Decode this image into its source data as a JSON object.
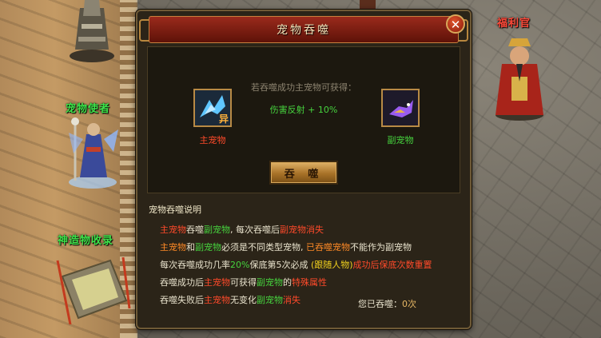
{
  "npcs": {
    "pet_envoy": "宠物使者",
    "welfare_officer": "福利官",
    "artifact_collector": "神造物收录"
  },
  "dialog": {
    "title": "宠物吞噬",
    "close_glyph": "✕",
    "gain_title": "若吞噬成功主宠物可获得：",
    "gain_value": "伤害反射 + 10%",
    "main_pet_label": "主宠物",
    "main_pet_badge": "异",
    "sub_pet_label": "副宠物",
    "devour_button": "吞 噬",
    "desc_title": "宠物吞噬说明",
    "lines": [
      [
        {
          "t": "主宠物",
          "c": "red"
        },
        {
          "t": "吞噬",
          "c": "white"
        },
        {
          "t": "副宠物",
          "c": "green"
        },
        {
          "t": ", 每次吞噬后",
          "c": "white"
        },
        {
          "t": "副宠物消失",
          "c": "red"
        }
      ],
      [
        {
          "t": "主宠物",
          "c": "orange"
        },
        {
          "t": "和",
          "c": "white"
        },
        {
          "t": "副宠物",
          "c": "green"
        },
        {
          "t": "必须是不同类型宠物, ",
          "c": "white"
        },
        {
          "t": "已吞噬宠物",
          "c": "orange"
        },
        {
          "t": "不能作为副宠物",
          "c": "white"
        }
      ],
      [
        {
          "t": "每次吞噬成功几率",
          "c": "white"
        },
        {
          "t": "20%",
          "c": "green"
        },
        {
          "t": "保底第5次必成 ",
          "c": "white"
        },
        {
          "t": "(跟随人物)",
          "c": "yellow"
        },
        {
          "t": "成功后保底次数重置",
          "c": "red"
        }
      ],
      [
        {
          "t": "吞噬成功后",
          "c": "white"
        },
        {
          "t": "主宠物",
          "c": "red"
        },
        {
          "t": "可获得",
          "c": "white"
        },
        {
          "t": "副宠物",
          "c": "green"
        },
        {
          "t": "的",
          "c": "white"
        },
        {
          "t": "特殊属性",
          "c": "red"
        }
      ],
      [
        {
          "t": "吞噬失败后",
          "c": "white"
        },
        {
          "t": "主宠物",
          "c": "red"
        },
        {
          "t": "无变化",
          "c": "white"
        },
        {
          "t": "副宠物",
          "c": "green"
        },
        {
          "t": "消失",
          "c": "red"
        }
      ]
    ],
    "count_label": "您已吞噬：",
    "count_value": "0次"
  },
  "colors": {
    "red": "#ff4a2a",
    "green": "#46d33e",
    "orange": "#ff8a26",
    "yellow": "#f2d21e",
    "white": "#e9e3cd"
  }
}
